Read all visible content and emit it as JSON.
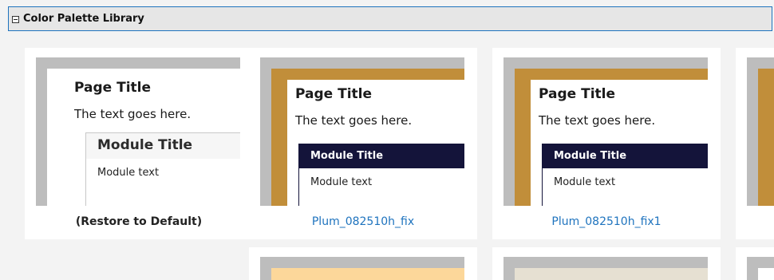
{
  "section": {
    "title": "Color Palette Library"
  },
  "palettes": [
    {
      "caption": "(Restore to Default)",
      "page_title": "Page Title",
      "page_text": "The text goes here.",
      "module_title": "Module Title",
      "module_text": "Module text"
    },
    {
      "caption": "Plum_082510h_fix",
      "page_title": "Page Title",
      "page_text": "The text goes here.",
      "module_title": "Module Title",
      "module_text": "Module text"
    },
    {
      "caption": "Plum_082510h_fix1",
      "page_title": "Page Title",
      "page_text": "The text goes here.",
      "module_title": "Module Title",
      "module_text": "Module text"
    }
  ],
  "colors": {
    "accent_gold": "#c18e3a",
    "module_navy": "#14143a",
    "link_blue": "#1e73be",
    "peach": "#fcd79a",
    "beige": "#e6e0d2"
  }
}
